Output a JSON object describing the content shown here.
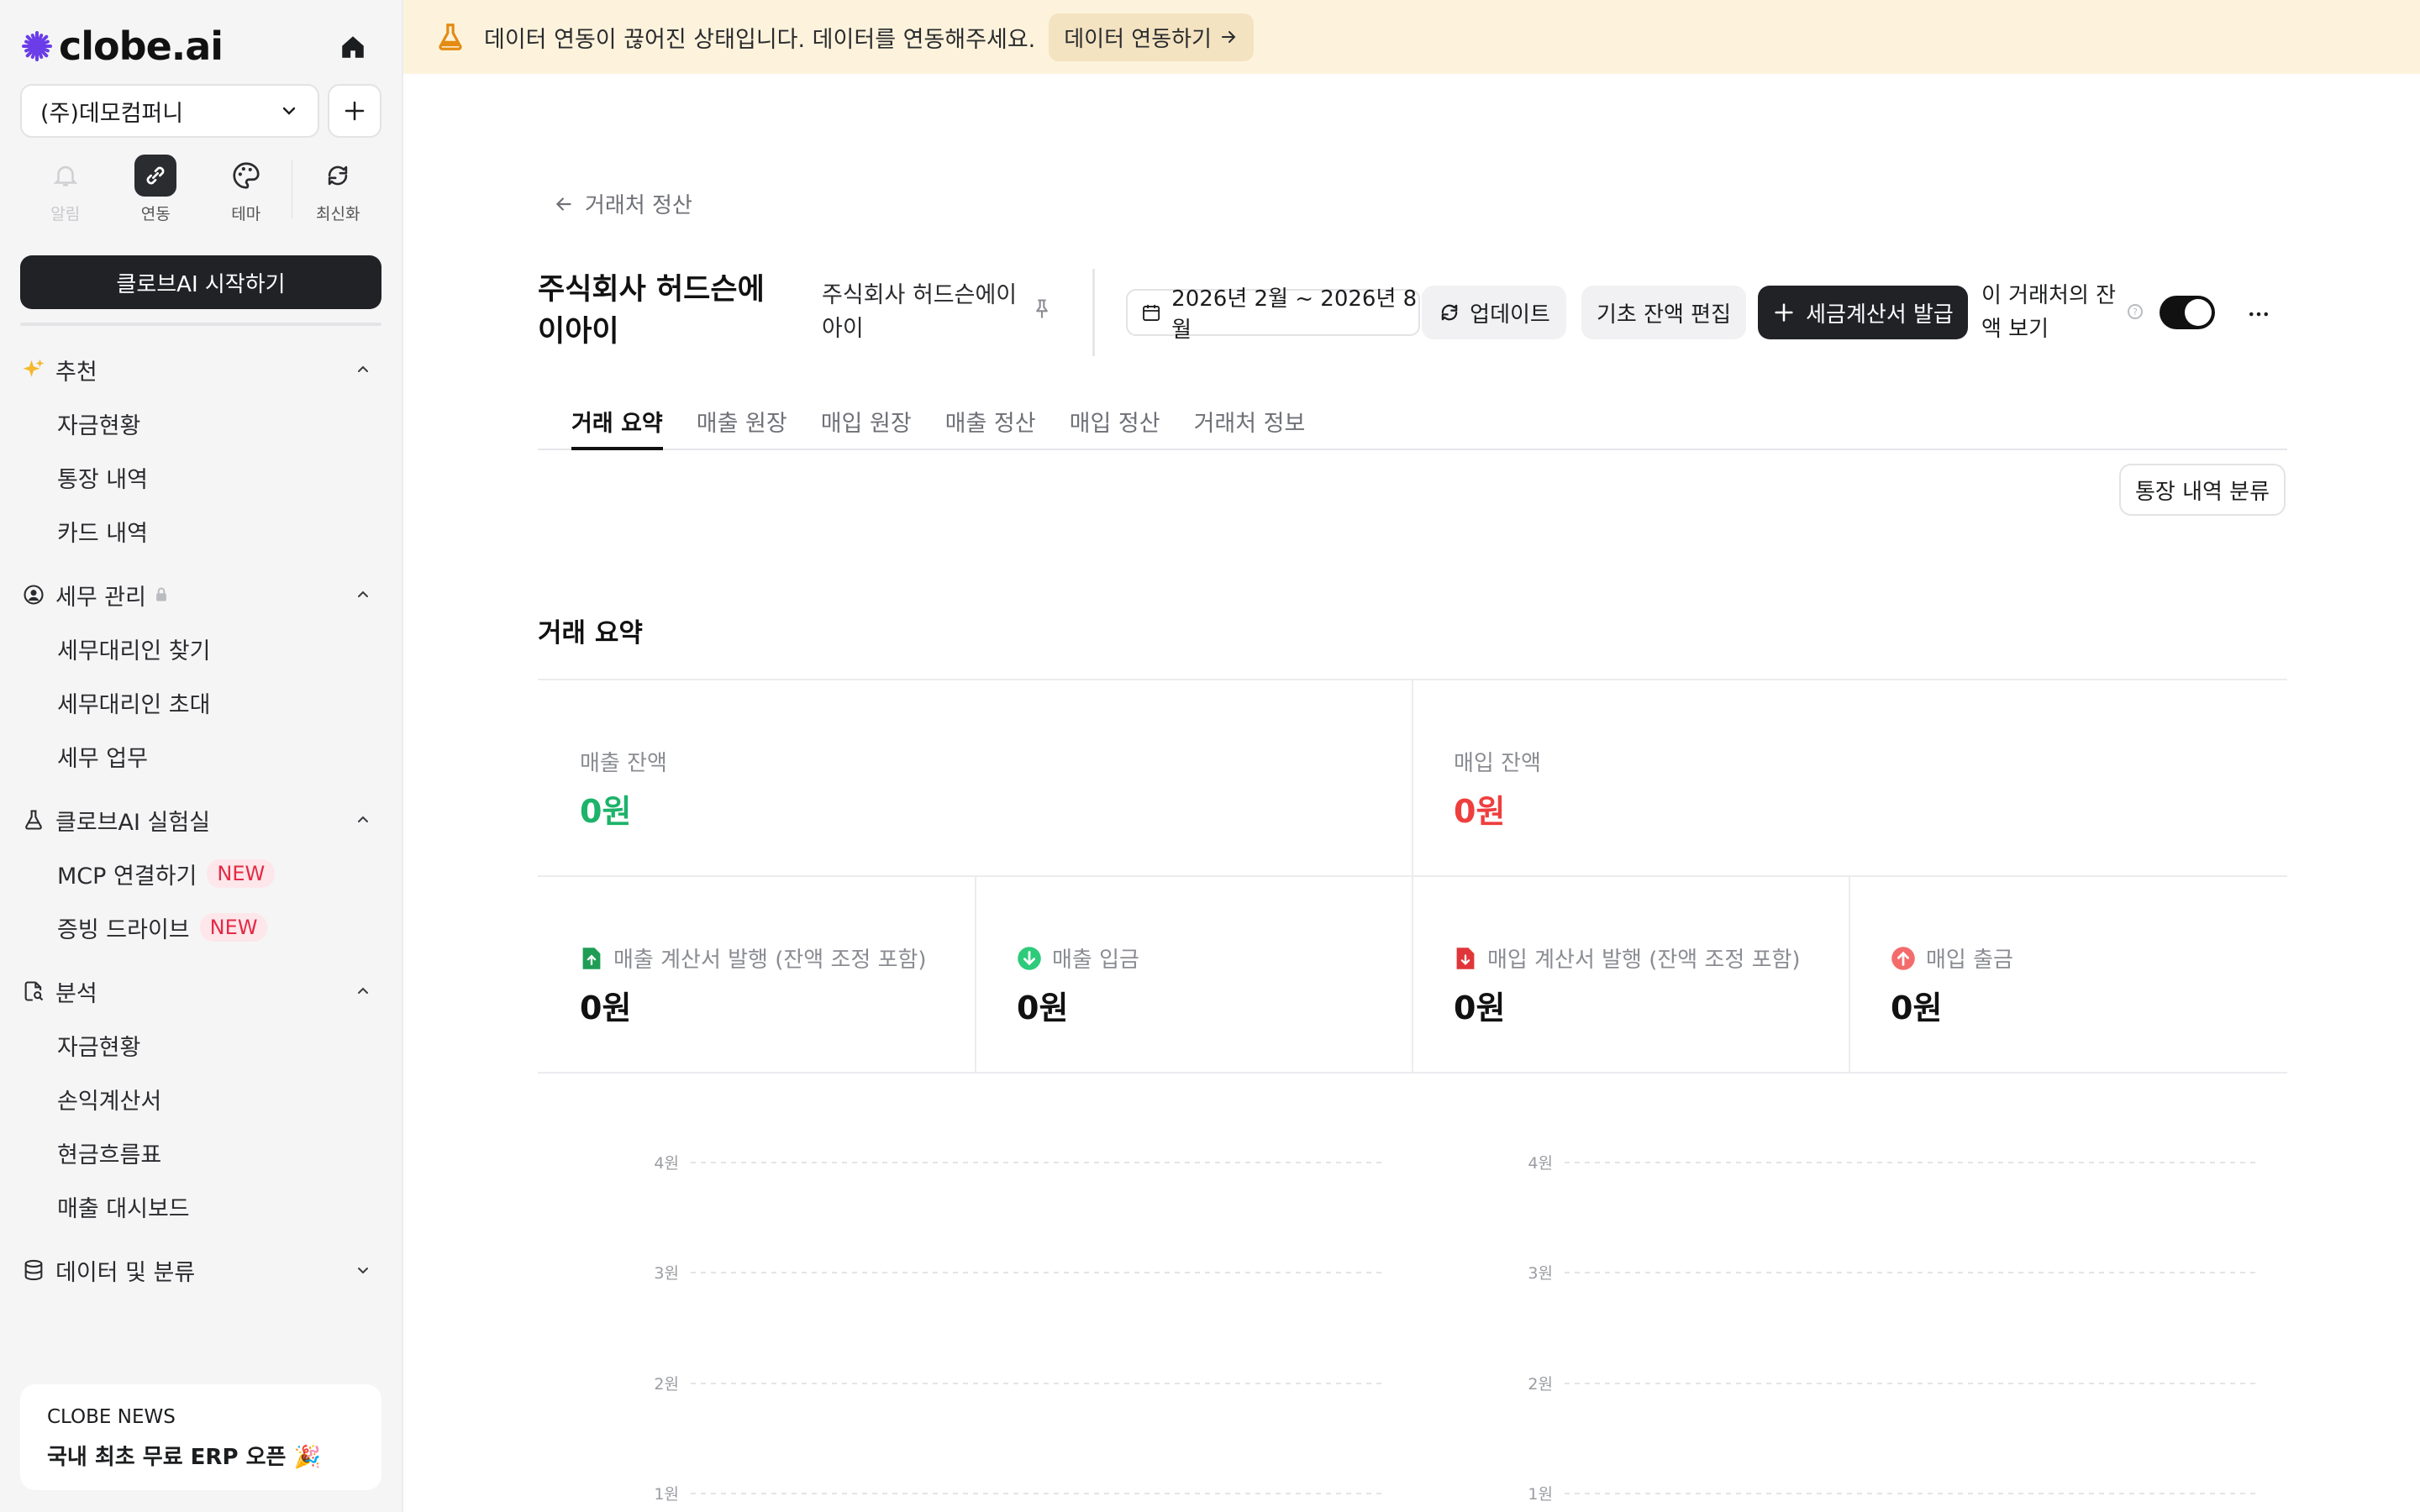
{
  "sidebar": {
    "logo_text": "clobe.ai",
    "company": "(주)데모컴퍼니",
    "quick_actions": [
      {
        "label": "알림",
        "icon": "bell-icon"
      },
      {
        "label": "연동",
        "icon": "link-icon"
      },
      {
        "label": "테마",
        "icon": "palette-icon"
      },
      {
        "label": "최신화",
        "icon": "refresh-icon"
      }
    ],
    "start_button": "클로브AI 시작하기",
    "sections": [
      {
        "title": "추천",
        "icon": "sparkle-icon",
        "items": [
          "자금현황",
          "통장 내역",
          "카드 내역"
        ]
      },
      {
        "title": "세무 관리",
        "icon": "shield-user-icon",
        "items": [
          "세무대리인 찾기",
          "세무대리인 초대",
          "세무 업무"
        ]
      },
      {
        "title": "클로브AI 실험실",
        "icon": "flask-icon",
        "items": [
          "MCP 연결하기",
          "증빙 드라이브"
        ],
        "badge": "NEW"
      },
      {
        "title": "분석",
        "icon": "document-search-icon",
        "items": [
          "자금현황",
          "손익계산서",
          "현금흐름표",
          "매출 대시보드"
        ]
      },
      {
        "title": "데이터 및 분류",
        "icon": "database-icon",
        "items": []
      }
    ],
    "news": {
      "label": "CLOBE NEWS",
      "title": "국내 최초 무료 ERP 오픈 🎉"
    }
  },
  "banner": {
    "message": "데이터 연동이 끊어진 상태입니다. 데이터를 연동해주세요.",
    "button": "데이터 연동하기"
  },
  "header": {
    "back_label": "거래처 정산",
    "company_name": "주식회사 허드슨에이아이",
    "company_sub": "주식회사 허드슨에이아이",
    "date_range": "2026년 2월 ~ 2026년 8월",
    "update_label": "업데이트",
    "base_balance_label": "기초 잔액 편집",
    "tax_invoice_label": "세금계산서 발급",
    "toggle_label": "이 거래처의 잔액 보기",
    "toggle_on": true
  },
  "tabs": [
    "거래 요약",
    "매출 원장",
    "매입 원장",
    "매출 정산",
    "매입 정산",
    "거래처 정보"
  ],
  "classify_button": "통장 내역 분류",
  "summary": {
    "title": "거래 요약",
    "sales_balance_label": "매출 잔액",
    "sales_balance_value": "0원",
    "purchase_balance_label": "매입 잔액",
    "purchase_balance_value": "0원",
    "cards": [
      {
        "label": "매출 계산서 발행 (잔액 조정 포함)",
        "value": "0원",
        "icon": "sales-invoice-icon"
      },
      {
        "label": "매출 입금",
        "value": "0원",
        "icon": "deposit-icon"
      },
      {
        "label": "매입 계산서 발행 (잔액 조정 포함)",
        "value": "0원",
        "icon": "purchase-invoice-icon"
      },
      {
        "label": "매입 출금",
        "value": "0원",
        "icon": "withdraw-icon"
      }
    ]
  },
  "chart_data": [
    {
      "type": "bar",
      "yticks": [
        "4원",
        "3원",
        "2원",
        "1원"
      ],
      "ylim": [
        0,
        4
      ],
      "grid": true
    },
    {
      "type": "bar",
      "yticks": [
        "4원",
        "3원",
        "2원",
        "1원"
      ],
      "ylim": [
        0,
        4
      ],
      "grid": true
    }
  ],
  "colors": {
    "sales": "#1db36a",
    "purchase": "#ef3e3e",
    "banner_bg": "#fdf3dc",
    "primary_dark": "#212226"
  }
}
